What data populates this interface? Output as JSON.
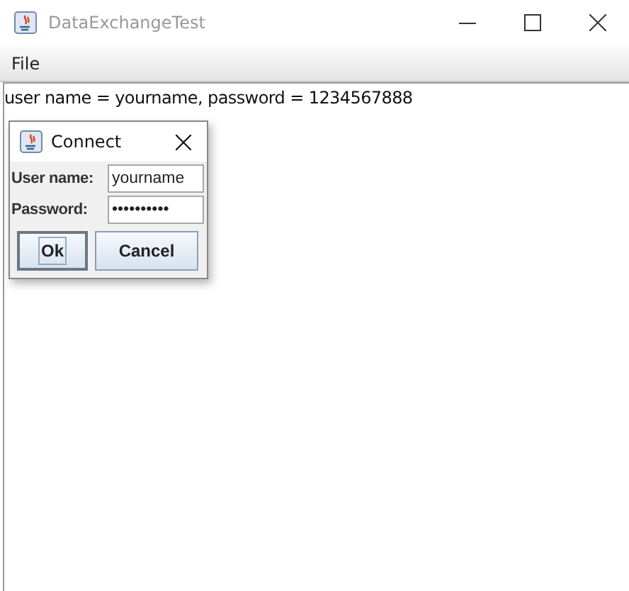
{
  "window": {
    "title": "DataExchangeTest"
  },
  "menu": [
    "File"
  ],
  "text_area": {
    "value": "user name = yourname, password = 1234567888"
  },
  "dialog": {
    "title": "Connect",
    "fields": [
      {
        "label": "User name:",
        "value": "yourname"
      },
      {
        "label": "Password:",
        "value": "••••••••••"
      }
    ],
    "buttons": [
      {
        "label": "Ok",
        "focused": true
      },
      {
        "label": "Cancel",
        "focused": false
      }
    ]
  }
}
